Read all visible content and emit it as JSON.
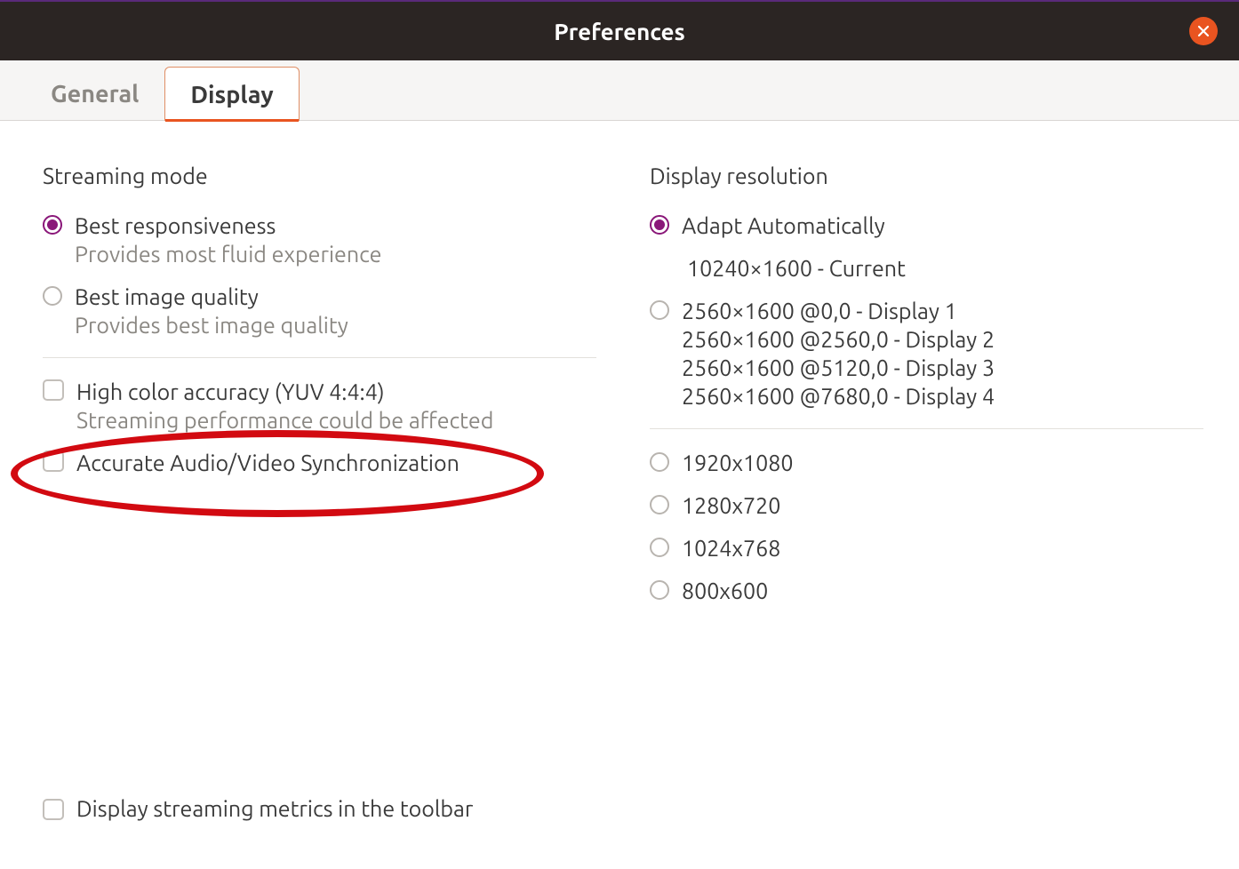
{
  "title": "Preferences",
  "tabs": {
    "general": "General",
    "display": "Display"
  },
  "streaming": {
    "heading": "Streaming mode",
    "best_responsiveness": {
      "label": "Best responsiveness",
      "desc": "Provides most fluid experience"
    },
    "best_image_quality": {
      "label": "Best image quality",
      "desc": "Provides best image quality"
    },
    "high_color": {
      "label": "High color accuracy (YUV 4:4:4)",
      "desc": "Streaming performance could be affected"
    },
    "av_sync": {
      "label": "Accurate Audio/Video Synchronization"
    }
  },
  "resolution": {
    "heading": "Display resolution",
    "adapt": {
      "label": "Adapt Automatically",
      "current": "10240×1600 - Current"
    },
    "multi": {
      "d1": "2560×1600 @0,0 - Display 1",
      "d2": "2560×1600 @2560,0 - Display 2",
      "d3": "2560×1600 @5120,0 - Display 3",
      "d4": "2560×1600 @7680,0 - Display 4"
    },
    "r1920": "1920x1080",
    "r1280": "1280x720",
    "r1024": "1024x768",
    "r800": "800x600"
  },
  "footer": {
    "metrics": "Display streaming metrics in the toolbar"
  },
  "colors": {
    "accent": "#e95420",
    "radio_checked": "#8a1779",
    "annotation": "#d20a11"
  }
}
